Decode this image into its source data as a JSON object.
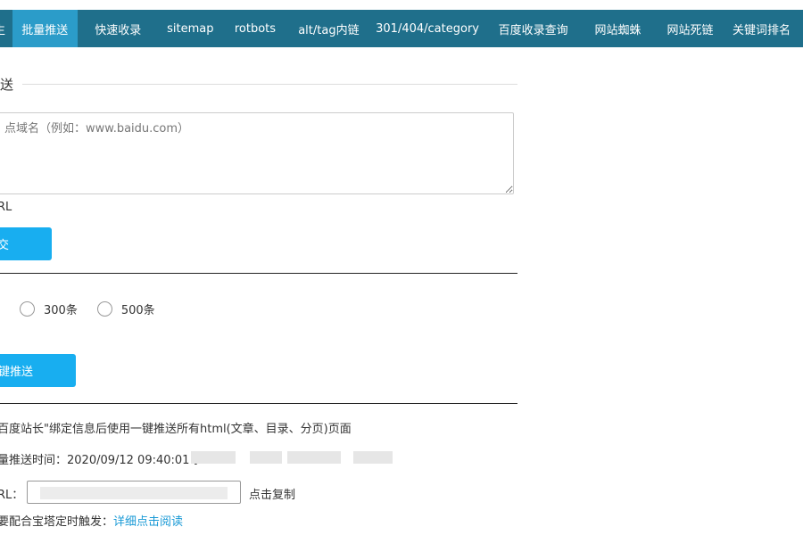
{
  "nav": {
    "tabs": [
      {
        "label": "生",
        "active": false
      },
      {
        "label": "批量推送",
        "active": true
      },
      {
        "label": "快速收录",
        "active": false
      },
      {
        "label": "sitemap",
        "active": false
      },
      {
        "label": "rotbots",
        "active": false
      },
      {
        "label": "alt/tag内链",
        "active": false
      },
      {
        "label": "301/404/category",
        "active": false
      },
      {
        "label": "百度收录查询",
        "active": false
      },
      {
        "label": "网站蜘蛛",
        "active": false
      },
      {
        "label": "网站死链",
        "active": false
      },
      {
        "label": "关键词排名",
        "active": false
      }
    ]
  },
  "section": {
    "title": "送"
  },
  "textarea": {
    "placeholder": "点域名（例如：www.baidu.com）"
  },
  "url_hint": "RL",
  "submit_button": "交",
  "radios": [
    {
      "label": "300条"
    },
    {
      "label": "500条"
    }
  ],
  "push_button": "键推送",
  "info": {
    "line1": "百度站长\"绑定信息后使用一键推送所有html(文章、目录、分页)页面",
    "line2_prefix": "量推送时间：2020/09/12 09:40:01 扌",
    "url_label": "RL：",
    "copy_label": "点击复制",
    "line4_prefix": "要配合宝塔定时触发：",
    "line4_link": "详细点击阅读"
  }
}
